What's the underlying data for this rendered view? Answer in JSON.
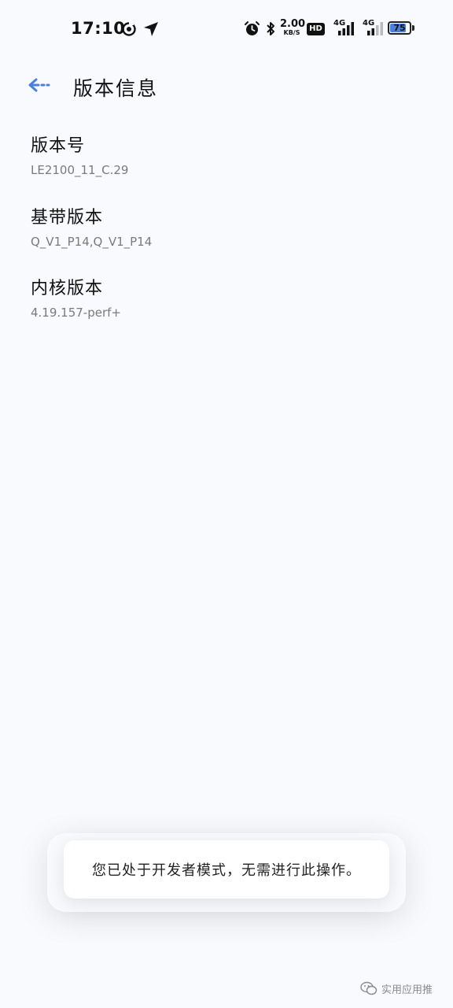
{
  "status_bar": {
    "time": "17:10",
    "network_speed_value": "2.00",
    "network_speed_unit": "KB/S",
    "hd_label": "HD",
    "sim1_type": "4G",
    "sim2_type": "4G",
    "battery_level": "75"
  },
  "header": {
    "title": "版本信息",
    "back_icon": "back-arrow-icon"
  },
  "items": [
    {
      "title": "版本号",
      "value": "LE2100_11_C.29"
    },
    {
      "title": "基带版本",
      "value": "Q_V1_P14,Q_V1_P14"
    },
    {
      "title": "内核版本",
      "value": "4.19.157-perf+"
    }
  ],
  "toast": {
    "message": "您已处于开发者模式，无需进行此操作。"
  },
  "watermark": {
    "text": "实用应用推"
  },
  "colors": {
    "background": "#f9fafd",
    "accent": "#4a7fe0",
    "secondary_text": "#7a7a7a"
  }
}
